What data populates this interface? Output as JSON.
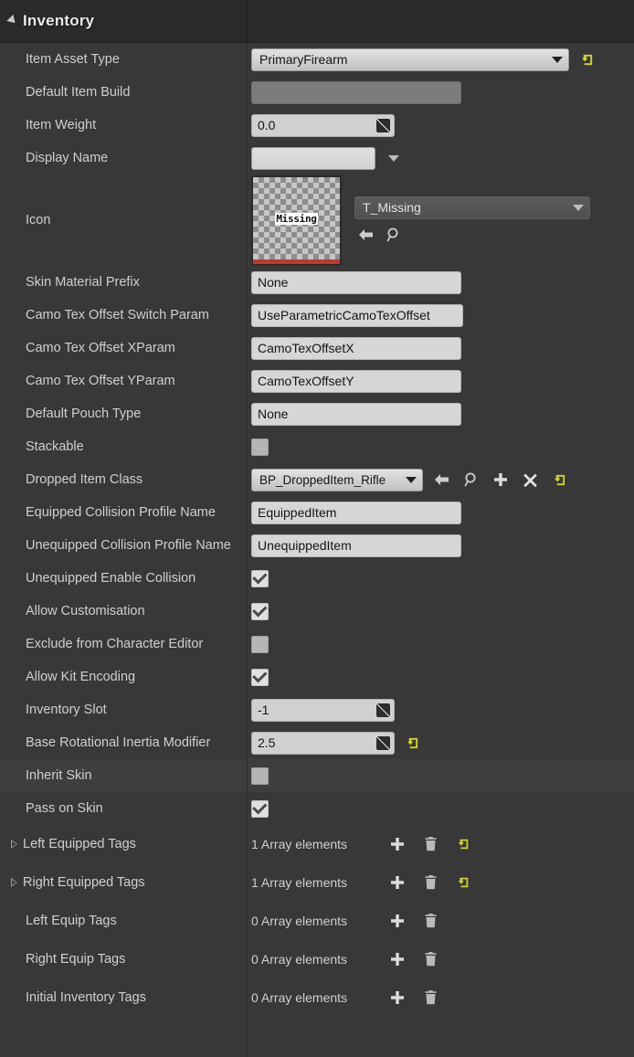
{
  "panel": {
    "category_title": "Inventory",
    "collapse_icon": "triangle-down-icon"
  },
  "labels": {
    "array_elements_1": "1 Array elements",
    "array_elements_0": "0 Array elements"
  },
  "rows": [
    {
      "label": "Item Asset Type",
      "value": "PrimaryFirearm"
    },
    {
      "label": "Default Item Build",
      "value": ""
    },
    {
      "label": "Item Weight",
      "value": "0.0"
    },
    {
      "label": "Display Name",
      "value": ""
    },
    {
      "label": "Icon",
      "value": "T_Missing",
      "thumb_text": "Missing"
    },
    {
      "label": "Skin Material Prefix",
      "value": "None"
    },
    {
      "label": "Camo Tex Offset Switch Param",
      "value": "UseParametricCamoTexOffset"
    },
    {
      "label": "Camo Tex Offset XParam",
      "value": "CamoTexOffsetX"
    },
    {
      "label": "Camo Tex Offset YParam",
      "value": "CamoTexOffsetY"
    },
    {
      "label": "Default Pouch Type",
      "value": "None"
    },
    {
      "label": "Stackable",
      "value": false
    },
    {
      "label": "Dropped Item Class",
      "value": "BP_DroppedItem_Rifle"
    },
    {
      "label": "Equipped Collision Profile Name",
      "value": "EquippedItem"
    },
    {
      "label": "Unequipped Collision Profile Name",
      "value": "UnequippedItem"
    },
    {
      "label": "Unequipped Enable Collision",
      "value": true
    },
    {
      "label": "Allow Customisation",
      "value": true
    },
    {
      "label": "Exclude from Character Editor",
      "value": false
    },
    {
      "label": "Allow Kit Encoding",
      "value": true
    },
    {
      "label": "Inventory Slot",
      "value": "-1"
    },
    {
      "label": "Base Rotational Inertia Modifier",
      "value": "2.5"
    },
    {
      "label": "Inherit Skin",
      "value": false
    },
    {
      "label": "Pass on Skin",
      "value": true
    },
    {
      "label": "Left Equipped Tags",
      "value": "1 Array elements"
    },
    {
      "label": "Right Equipped Tags",
      "value": "1 Array elements"
    },
    {
      "label": "Left Equip Tags",
      "value": "0 Array elements"
    },
    {
      "label": "Right Equip Tags",
      "value": "0 Array elements"
    },
    {
      "label": "Initial Inventory Tags",
      "value": "0 Array elements"
    }
  ],
  "colors": {
    "panel_bg": "#383838",
    "header_bg": "#2a2a2a",
    "row_highlight": "#3e3e3e",
    "label_text": "#cfcfcf",
    "field_bg": "#d6d6d6",
    "reset_arrow": "#d4d12a",
    "thumb_error_bar": "#c0392b"
  }
}
